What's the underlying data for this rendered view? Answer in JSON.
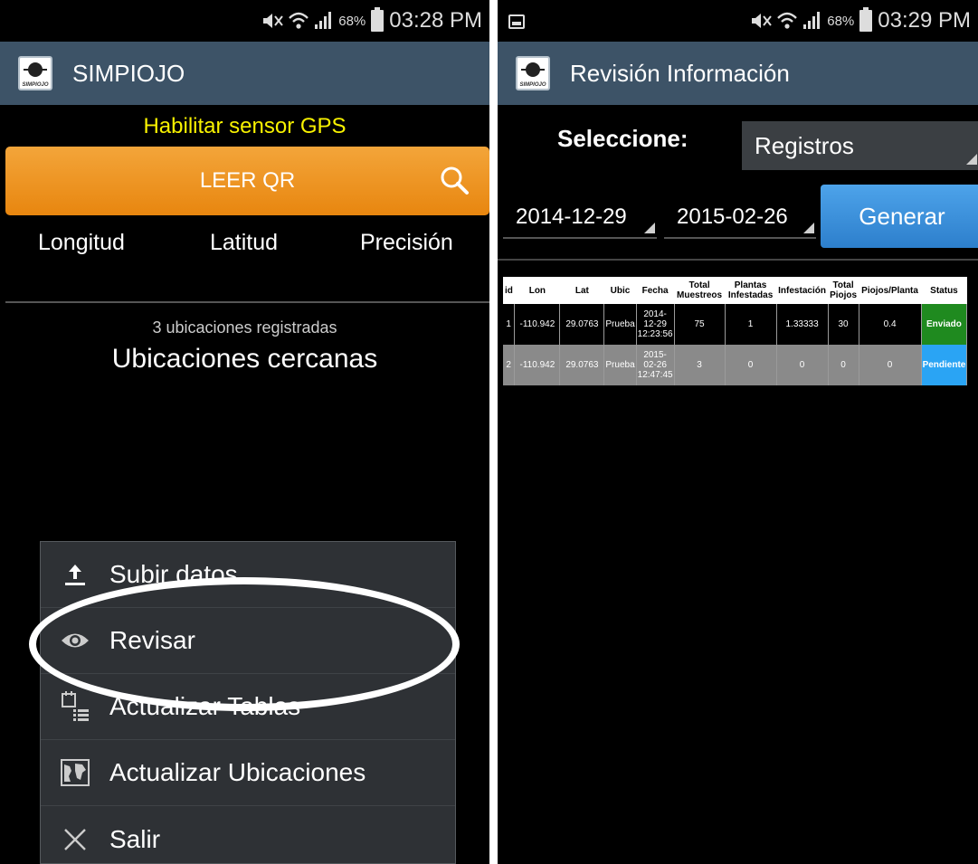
{
  "left": {
    "status_bar": {
      "battery": "68%",
      "time": "03:28 PM"
    },
    "action_bar": {
      "logo_text": "SIMPIOJO",
      "title": "SIMPIOJO"
    },
    "gps_warning": "Habilitar sensor GPS",
    "qr_button": "LEER QR",
    "coords": {
      "lon": "Longitud",
      "lat": "Latitud",
      "precision": "Precisión"
    },
    "locations_count": "3 ubicaciones registradas",
    "nearby_title": "Ubicaciones cercanas",
    "menu": [
      {
        "label": "Subir datos",
        "icon": "upload-icon"
      },
      {
        "label": "Revisar",
        "icon": "eye-icon"
      },
      {
        "label": "Actualizar Tablas",
        "icon": "table-list-icon"
      },
      {
        "label": "Actualizar Ubicaciones",
        "icon": "map-icon"
      },
      {
        "label": "Salir",
        "icon": "close-icon"
      }
    ]
  },
  "right": {
    "status_bar": {
      "battery": "68%",
      "time": "03:29 PM"
    },
    "action_bar": {
      "logo_text": "SIMPIOJO",
      "title": "Revisión Información"
    },
    "select_label": "Seleccione:",
    "select_value": "Registros",
    "date_from": "2014-12-29",
    "date_to": "2015-02-26",
    "generate_button": "Generar",
    "table": {
      "headers": [
        "id",
        "Lon",
        "Lat",
        "Ubic",
        "Fecha",
        "Total Muestreos",
        "Plantas Infestadas",
        "Infestación",
        "Total Piojos",
        "Piojos/Planta",
        "Status"
      ],
      "rows": [
        [
          "1",
          "-110.942",
          "29.0763",
          "Prueba",
          "2014-12-29 12:23:56",
          "75",
          "1",
          "1.33333",
          "30",
          "0.4",
          "Enviado"
        ],
        [
          "2",
          "-110.942",
          "29.0763",
          "Prueba",
          "2015-02-26 12:47:45",
          "3",
          "0",
          "0",
          "0",
          "0",
          "Pendiente"
        ]
      ]
    }
  },
  "colors": {
    "action_bar": "#3d5367",
    "qr_button": "#ee9a25",
    "gps_warning": "#f8f200",
    "generate_button": "#3a8fdc",
    "status_sent": "#1f8a1f",
    "status_pending": "#2aa4f4"
  }
}
